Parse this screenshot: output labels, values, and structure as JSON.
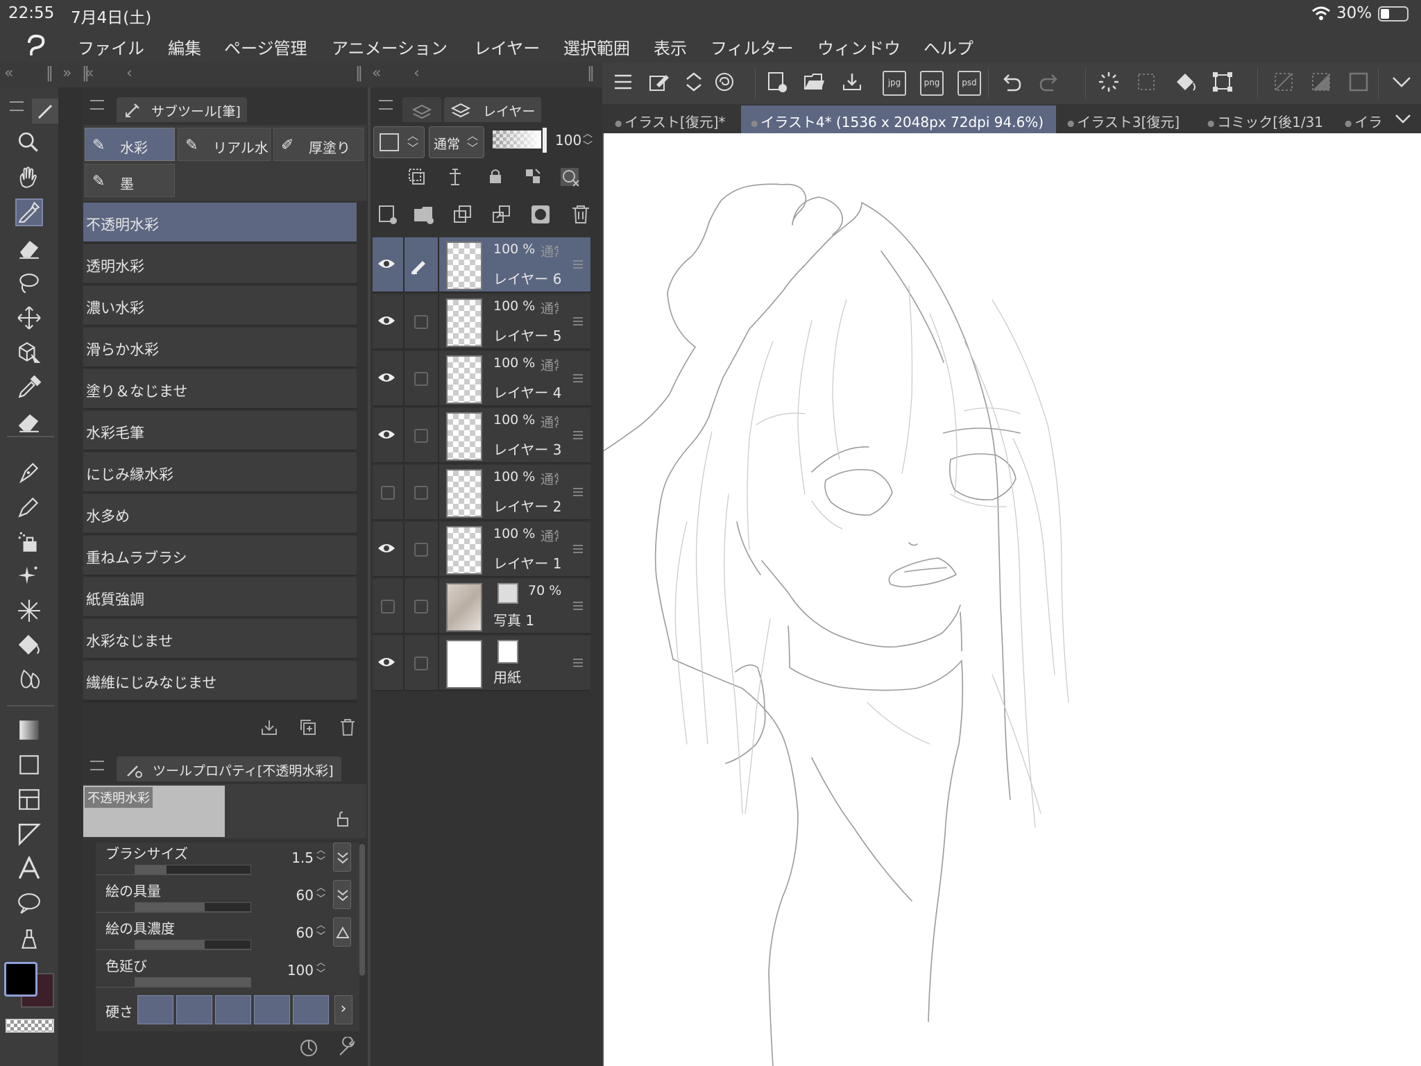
{
  "status": {
    "time": "22:55",
    "date": "7月4日(土)",
    "battery": "30%"
  },
  "menu": [
    "ファイル",
    "編集",
    "ページ管理",
    "アニメーション",
    "レイヤー",
    "選択範囲",
    "表示",
    "フィルター",
    "ウィンドウ",
    "ヘルプ"
  ],
  "subtool": {
    "title": "サブツール[筆]",
    "groups": [
      "水彩",
      "リアル水",
      "厚塗り",
      "墨"
    ],
    "items": [
      "不透明水彩",
      "透明水彩",
      "濃い水彩",
      "滑らか水彩",
      "塗り＆なじませ",
      "水彩毛筆",
      "にじみ縁水彩",
      "水多め",
      "重ねムラブラシ",
      "紙質強調",
      "水彩なじませ",
      "繊維にじみなじませ"
    ]
  },
  "toolprop": {
    "title": "ツールプロパティ[不透明水彩]",
    "preview_label": "不透明水彩",
    "props": [
      {
        "label": "ブラシサイズ",
        "value": "1.5"
      },
      {
        "label": "絵の具量",
        "value": "60"
      },
      {
        "label": "絵の具濃度",
        "value": "60"
      },
      {
        "label": "色延び",
        "value": "100"
      }
    ],
    "hardness_label": "硬さ"
  },
  "layers": {
    "title": "レイヤー",
    "blend_mode": "通常",
    "opacity": "100",
    "rows": [
      {
        "pct": "100 %",
        "mode": "通常",
        "name": "レイヤー 6"
      },
      {
        "pct": "100 %",
        "mode": "通常",
        "name": "レイヤー 5"
      },
      {
        "pct": "100 %",
        "mode": "通常",
        "name": "レイヤー 4"
      },
      {
        "pct": "100 %",
        "mode": "通常",
        "name": "レイヤー 3"
      },
      {
        "pct": "100 %",
        "mode": "通常",
        "name": "レイヤー 2"
      },
      {
        "pct": "100 %",
        "mode": "通常",
        "name": "レイヤー 1"
      },
      {
        "pct": "70 %",
        "name": "写真 1"
      },
      {
        "name": "用紙"
      }
    ]
  },
  "export_formats": [
    "jpg",
    "png",
    "psd"
  ],
  "doc_tabs": [
    "イラスト[復元]*",
    "イラスト4* (1536 x 2048px 72dpi 94.6%)",
    "イラスト3[復元]",
    "コミック[後1/31",
    "イラ"
  ]
}
